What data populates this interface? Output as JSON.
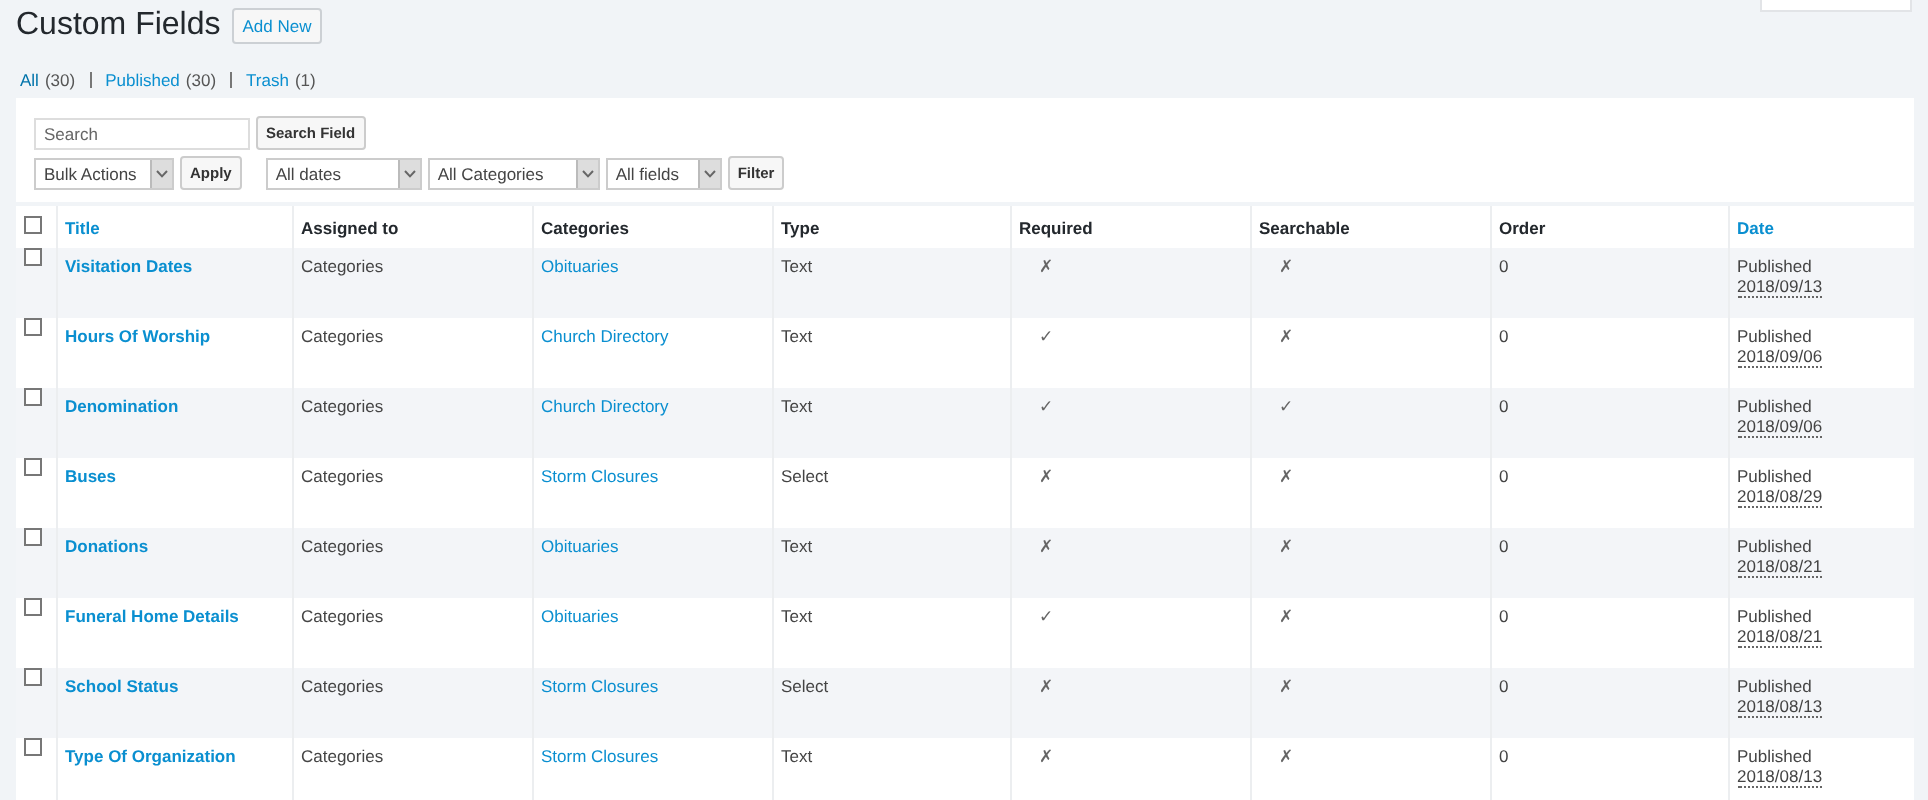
{
  "page": {
    "title": "Custom Fields",
    "add_new": "Add New"
  },
  "status_links": [
    {
      "label": "All",
      "count": "(30)",
      "selected": true
    },
    {
      "label": "Published",
      "count": "(30)",
      "selected": false
    },
    {
      "label": "Trash",
      "count": "(1)",
      "selected": false
    }
  ],
  "search": {
    "placeholder": "Search",
    "button": "Search Field"
  },
  "bulk_actions": {
    "value": "Bulk Actions",
    "button": "Apply"
  },
  "filters": [
    {
      "value": "All dates"
    },
    {
      "value": "All Categories"
    },
    {
      "value": "All fields"
    }
  ],
  "filter_button": "Filter",
  "table": {
    "select_all_checked": false,
    "columns": [
      {
        "label": "Title",
        "kind": "link"
      },
      {
        "label": "Assigned to",
        "kind": "plain"
      },
      {
        "label": "Categories",
        "kind": "plain"
      },
      {
        "label": "Type",
        "kind": "plain"
      },
      {
        "label": "Required",
        "kind": "plain"
      },
      {
        "label": "Searchable",
        "kind": "plain"
      },
      {
        "label": "Order",
        "kind": "plain"
      },
      {
        "label": "Date",
        "kind": "link"
      }
    ],
    "rows": [
      {
        "checked": false,
        "title": "Visitation Dates",
        "assigned_to": "Categories",
        "category": "Obituaries",
        "type": "Text",
        "required": "✗",
        "searchable": "✗",
        "order": "0",
        "status": "Published",
        "date": "2018/09/13"
      },
      {
        "checked": false,
        "title": "Hours Of Worship",
        "assigned_to": "Categories",
        "category": "Church Directory",
        "type": "Text",
        "required": "✓",
        "searchable": "✗",
        "order": "0",
        "status": "Published",
        "date": "2018/09/06"
      },
      {
        "checked": false,
        "title": "Denomination",
        "assigned_to": "Categories",
        "category": "Church Directory",
        "type": "Text",
        "required": "✓",
        "searchable": "✓",
        "order": "0",
        "status": "Published",
        "date": "2018/09/06"
      },
      {
        "checked": false,
        "title": "Buses",
        "assigned_to": "Categories",
        "category": "Storm Closures",
        "type": "Select",
        "required": "✗",
        "searchable": "✗",
        "order": "0",
        "status": "Published",
        "date": "2018/08/29"
      },
      {
        "checked": false,
        "title": "Donations",
        "assigned_to": "Categories",
        "category": "Obituaries",
        "type": "Text",
        "required": "✗",
        "searchable": "✗",
        "order": "0",
        "status": "Published",
        "date": "2018/08/21"
      },
      {
        "checked": false,
        "title": "Funeral Home Details",
        "assigned_to": "Categories",
        "category": "Obituaries",
        "type": "Text",
        "required": "✓",
        "searchable": "✗",
        "order": "0",
        "status": "Published",
        "date": "2018/08/21"
      },
      {
        "checked": false,
        "title": "School Status",
        "assigned_to": "Categories",
        "category": "Storm Closures",
        "type": "Select",
        "required": "✗",
        "searchable": "✗",
        "order": "0",
        "status": "Published",
        "date": "2018/08/13"
      },
      {
        "checked": false,
        "title": "Type Of Organization",
        "assigned_to": "Categories",
        "category": "Storm Closures",
        "type": "Text",
        "required": "✗",
        "searchable": "✗",
        "order": "0",
        "status": "Published",
        "date": "2018/08/13"
      }
    ]
  }
}
